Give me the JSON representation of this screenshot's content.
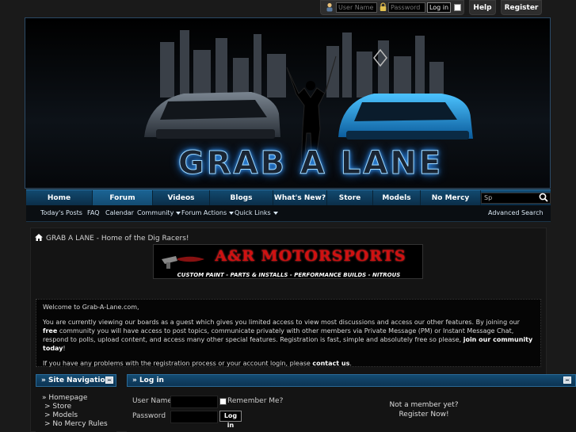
{
  "top_login": {
    "username_placeholder": "User Name",
    "password_placeholder": "Password",
    "login_label": "Log in",
    "help_label": "Help",
    "register_label": "Register"
  },
  "banner": {
    "logo_text": "GRAB A LANE"
  },
  "navbar": {
    "tabs": [
      {
        "label": "Home"
      },
      {
        "label": "Forum"
      },
      {
        "label": "Videos"
      },
      {
        "label": "Blogs"
      },
      {
        "label": "What's New?"
      },
      {
        "label": "Store"
      },
      {
        "label": "Models"
      },
      {
        "label": "No Mercy Rules"
      }
    ],
    "search_value": "Sp"
  },
  "subnav": {
    "items": [
      {
        "label": "Today's Posts"
      },
      {
        "label": "FAQ"
      },
      {
        "label": "Calendar"
      },
      {
        "label": "Community"
      },
      {
        "label": "Forum Actions"
      },
      {
        "label": "Quick Links"
      }
    ],
    "advanced_search": "Advanced Search"
  },
  "breadcrumb": {
    "text": "GRAB A LANE - Home of the Dig Racers!"
  },
  "ad": {
    "title": "A&R MOTORSPORTS",
    "subtitle": "CUSTOM PAINT - PARTS & INSTALLS - PERFORMANCE BUILDS - NITROUS"
  },
  "welcome": {
    "line1": "Welcome to Grab-A-Lane.com,",
    "p2_before": "You are currently viewing our boards as a guest which gives you limited access to view most discussions and access our other features. By joining our ",
    "p2_bold1": "free",
    "p2_middle": " community you will have access to post topics, communicate privately with other members via Private Message (PM) or Instant Message Chat, respond to polls, upload content, and access many other special features. Registration is fast, simple and absolutely free so please, ",
    "p2_bold2": "join our community today",
    "p2_end": "!",
    "p3_before": "If you have any problems with the registration process or your account login, please ",
    "p3_bold": "contact us",
    "p3_end": "."
  },
  "site_nav": {
    "title": "» Site Navigation",
    "items": [
      {
        "label": "» Homepage"
      },
      {
        "label": "> Store"
      },
      {
        "label": "> Models"
      },
      {
        "label": "> No Mercy Rules"
      }
    ]
  },
  "login_block": {
    "title": "» Log in",
    "username_label": "User Name",
    "password_label": "Password",
    "remember_label": "Remember Me?",
    "login_button": "Log in",
    "not_member_line1": "Not a member yet?",
    "not_member_line2": "Register Now!"
  },
  "colors": {
    "nav_blue": "#124a70",
    "logo_glow": "#3aa0ff",
    "ad_red": "#d01010"
  }
}
